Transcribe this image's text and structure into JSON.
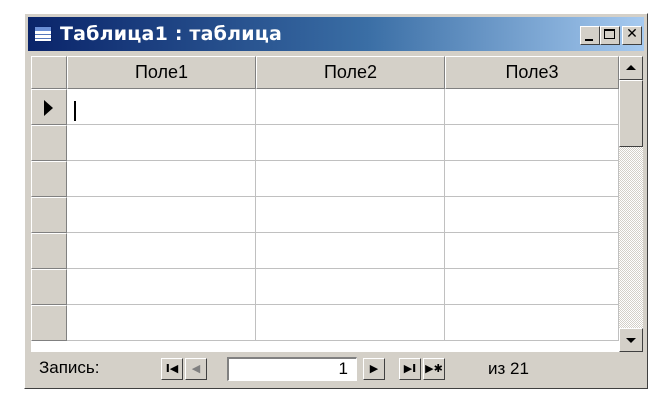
{
  "window": {
    "title": "Таблица1 : таблица",
    "close_glyph": "✕",
    "icons": [
      "table-icon",
      "minimize-icon",
      "maximize-icon",
      "close-icon"
    ]
  },
  "table": {
    "columns": [
      "Поле1",
      "Поле2",
      "Поле3"
    ],
    "visible_rows": 7,
    "current_row": 1
  },
  "navigation": {
    "label": "Запись:",
    "first_glyph": "I◀",
    "prev_glyph": "◀",
    "next_glyph": "▶",
    "last_glyph": "▶I",
    "new_glyph": "▶✱",
    "current_record": "1",
    "total_text": "из 21"
  },
  "colors": {
    "title_start": "#0a246a",
    "title_end": "#a6caf0",
    "face": "#d4d0c8"
  }
}
